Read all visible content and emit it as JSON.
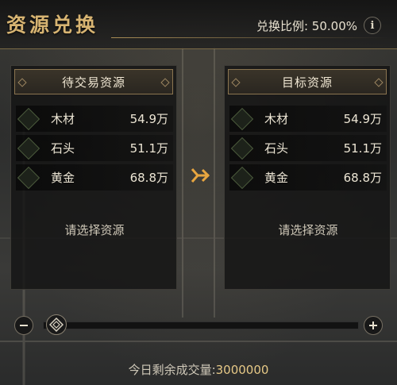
{
  "header": {
    "title": "资源兑换",
    "ratio_label": "兑换比例:",
    "ratio_value": "50.00%",
    "info_icon": "info-icon"
  },
  "left_panel": {
    "title": "待交易资源",
    "resources": [
      {
        "name": "木材",
        "amount": "54.9万",
        "icon": "wood-icon"
      },
      {
        "name": "石头",
        "amount": "51.1万",
        "icon": "stone-icon"
      },
      {
        "name": "黄金",
        "amount": "68.8万",
        "icon": "gold-icon"
      }
    ],
    "placeholder": "请选择资源"
  },
  "right_panel": {
    "title": "目标资源",
    "resources": [
      {
        "name": "木材",
        "amount": "54.9万",
        "icon": "wood-icon"
      },
      {
        "name": "石头",
        "amount": "51.1万",
        "icon": "stone-icon"
      },
      {
        "name": "黄金",
        "amount": "68.8万",
        "icon": "gold-icon"
      }
    ],
    "placeholder": "请选择资源"
  },
  "slider": {
    "level": 0,
    "minus_icon": "minus-icon",
    "plus_icon": "plus-icon",
    "thumb_icon": "diamond-thumb-icon"
  },
  "footer": {
    "label": "今日剩余成交量:",
    "value": "3000000"
  },
  "colors": {
    "title_gold": "#d7b472",
    "accent": "#e8a640",
    "text": "#ece5d4"
  }
}
